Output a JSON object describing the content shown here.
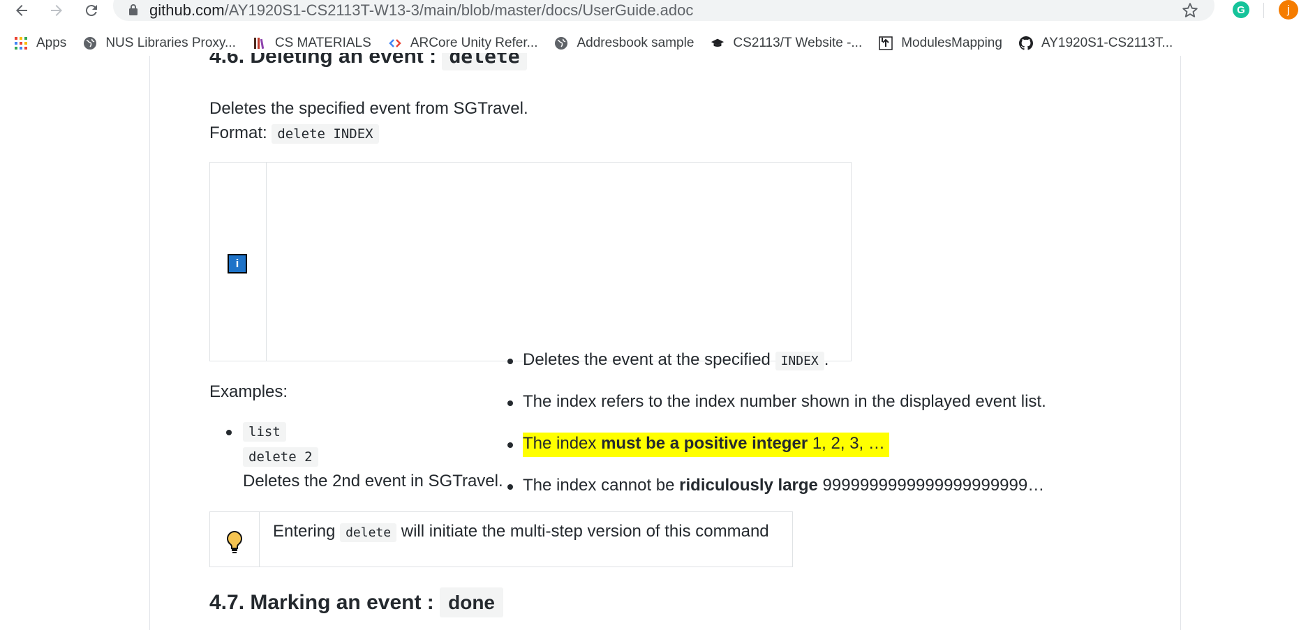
{
  "browser": {
    "url_host": "github.com",
    "url_path": "/AY1920S1-CS2113T-W13-3/main/blob/master/docs/UserGuide.adoc",
    "extension_letter": "G",
    "profile_letter": "j"
  },
  "bookmarks": [
    {
      "label": "Apps",
      "icon": "apps-grid-icon"
    },
    {
      "label": "NUS Libraries Proxy...",
      "icon": "globe-icon"
    },
    {
      "label": "CS MATERIALS",
      "icon": "cs-materials-icon"
    },
    {
      "label": "ARCore Unity Refer...",
      "icon": "arcore-icon"
    },
    {
      "label": "Addresbook sample",
      "icon": "globe-icon"
    },
    {
      "label": "CS2113/T Website -...",
      "icon": "graduation-cap-icon"
    },
    {
      "label": "ModulesMapping",
      "icon": "modules-icon"
    },
    {
      "label": "AY1920S1-CS2113T...",
      "icon": "github-icon"
    }
  ],
  "doc": {
    "section_46": {
      "number_title": "4.6. Deleting an event : ",
      "command": "delete"
    },
    "desc": "Deletes the specified event from SGTravel.",
    "format_label": "Format: ",
    "format_code": "delete INDEX",
    "notes": {
      "b1_pre": "Deletes the event at the specified ",
      "b1_code": "INDEX",
      "b1_post": ".",
      "b2": "The index refers to the index number shown in the displayed event list.",
      "b3_pre": "The index ",
      "b3_bold": "must be a positive integer",
      "b3_post": " 1, 2, 3, …",
      "b4_pre": "The index cannot be ",
      "b4_bold": "ridiculously large",
      "b4_post": " 9999999999999999999999…"
    },
    "examples_label": "Examples:",
    "example_code1": "list",
    "example_code2": "delete 2",
    "example_desc": "Deletes the 2nd event in SGTravel.",
    "tip": {
      "pre": "Entering ",
      "code": "delete",
      "post": " will initiate the multi-step version of this command"
    },
    "section_47": {
      "number_title": "4.7. Marking an event : ",
      "command": "done"
    }
  },
  "colors": {
    "highlight": "#ffff00",
    "info_icon": "#1e73c8",
    "profile": "#f57c00",
    "grammarly": "#15c39a"
  }
}
